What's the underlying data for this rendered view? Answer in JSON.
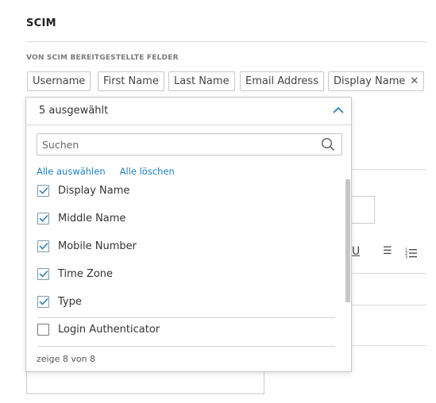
{
  "section": {
    "title": "SCIM"
  },
  "provided_fields": {
    "label": "VON SCIM BEREITGESTELLTE FELDER",
    "chips": [
      "Username",
      "First Name",
      "Last Name",
      "Email Address",
      "Display Name"
    ],
    "remove_glyph": "✕"
  },
  "dropdown": {
    "summary": "5 ausgewählt",
    "search_placeholder": "Suchen",
    "select_all": "Alle auswählen",
    "clear_all": "Alle löschen",
    "options": [
      {
        "label": "Display Name",
        "checked": true
      },
      {
        "label": "Middle Name",
        "checked": true
      },
      {
        "label": "Mobile Number",
        "checked": true
      },
      {
        "label": "Time Zone",
        "checked": true
      },
      {
        "label": "Type",
        "checked": true
      },
      {
        "label": "Login Authenticator",
        "checked": false
      }
    ],
    "footer": "zeige 8 von 8"
  },
  "background": {
    "underline_glyph": "U",
    "bullet_list_glyph": "☰"
  },
  "colors": {
    "accent": "#1a7fc1",
    "border": "#c8c8c8"
  },
  "icons": {
    "chevron": "chevron-up-icon",
    "search": "search-icon",
    "checkbox": "check-icon"
  }
}
